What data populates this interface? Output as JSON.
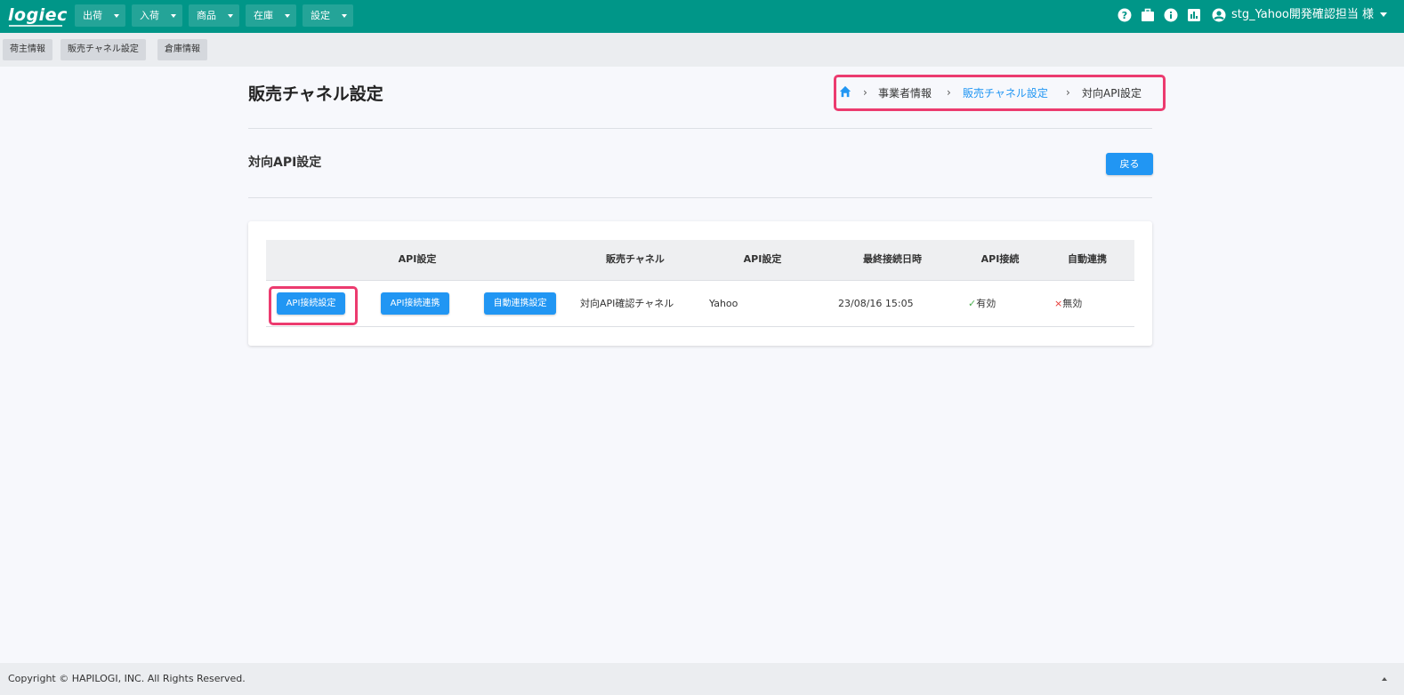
{
  "header": {
    "logo": "logiec",
    "menus": [
      {
        "label": "出荷"
      },
      {
        "label": "入荷"
      },
      {
        "label": "商品"
      },
      {
        "label": "在庫"
      },
      {
        "label": "設定"
      }
    ],
    "icons": [
      "help-icon",
      "briefcase-icon",
      "info-icon",
      "chart-icon",
      "account-icon"
    ],
    "user": "stg_Yahoo開発確認担当 様"
  },
  "subnav": [
    {
      "label": "荷主情報"
    },
    {
      "label": "販売チャネル設定"
    },
    {
      "label": "倉庫情報"
    }
  ],
  "page": {
    "title": "販売チャネル設定",
    "breadcrumb": [
      {
        "label": "事業者情報"
      },
      {
        "label": "販売チャネル設定"
      },
      {
        "label": "対向API設定"
      }
    ],
    "section_title": "対向API設定",
    "back_label": "戻る"
  },
  "table": {
    "headers": [
      "API設定",
      "販売チャネル",
      "API設定",
      "最終接続日時",
      "API接続",
      "自動連携"
    ],
    "rows": [
      {
        "buttons": [
          "API接続設定",
          "API接続連携",
          "自動連携設定"
        ],
        "channel": "対向API確認チャネル",
        "api_setting": "Yahoo",
        "last_connected": "23/08/16 15:05",
        "api_connection": "有効",
        "auto_link": "無効"
      }
    ]
  },
  "footer": {
    "copyright": "Copyright © HAPILOGI, INC. All Rights Reserved."
  },
  "colors": {
    "header_bg": "#009688",
    "primary": "#2196f3",
    "highlight": "#ec3b6f"
  }
}
